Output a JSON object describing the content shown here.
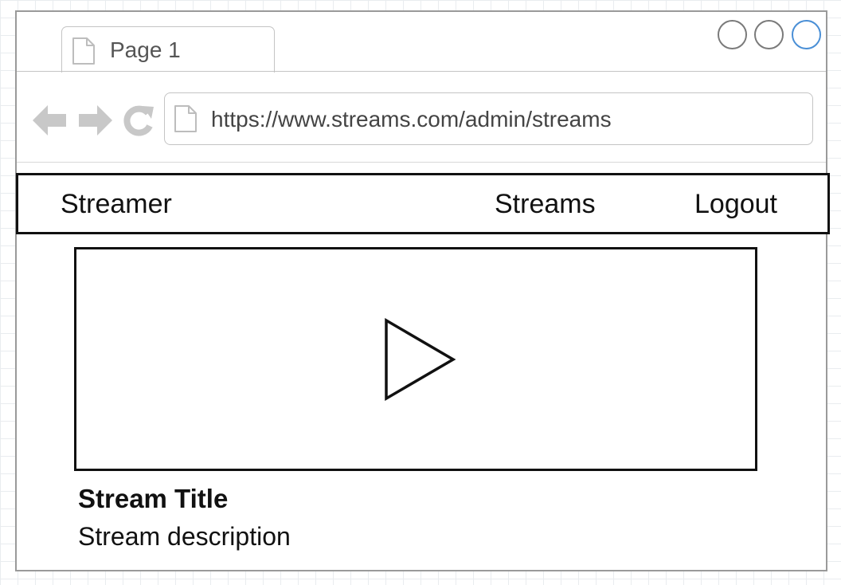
{
  "browser": {
    "tab": {
      "label": "Page 1",
      "icon": "page-icon"
    },
    "window_controls": [
      "circle-icon",
      "circle-icon",
      "circle-icon"
    ],
    "address_bar": {
      "url": "https://www.streams.com/admin/streams",
      "icon": "page-icon"
    },
    "nav_icons": [
      "arrow-left-icon",
      "arrow-right-icon",
      "reload-icon"
    ]
  },
  "app": {
    "navbar": {
      "brand": "Streamer",
      "links": [
        {
          "label": "Streams"
        },
        {
          "label": "Logout"
        }
      ]
    },
    "stream": {
      "player_icon": "play-icon",
      "title": "Stream Title",
      "description": "Stream description"
    }
  },
  "colors": {
    "chrome_gray": "#c4c4c4",
    "content_stroke": "#111111",
    "active_control": "#4a8fd6"
  }
}
